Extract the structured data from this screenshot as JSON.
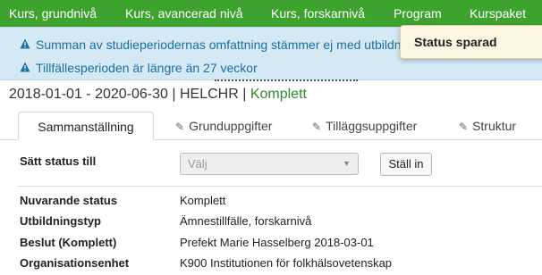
{
  "topnav": {
    "items": [
      "Kurs, grundnivå",
      "Kurs, avancerad nivå",
      "Kurs, forskarnivå",
      "Program",
      "Kurspaket"
    ]
  },
  "alerts": {
    "items": [
      "Summan av studieperiodernas omfattning stämmer ej med utbildn",
      "Tillfällesperioden är längre än 27 veckor"
    ]
  },
  "toast": {
    "message": "Status sparad"
  },
  "subheader": {
    "period": "2018-01-01 - 2020-06-30",
    "code": "HELCHR",
    "separator": "|",
    "status": "Komplett"
  },
  "tabs": [
    {
      "label": "Sammanställning",
      "active": true
    },
    {
      "label": "Grunduppgifter",
      "active": false
    },
    {
      "label": "Tilläggsuppgifter",
      "active": false
    },
    {
      "label": "Struktur",
      "active": false
    }
  ],
  "status_form": {
    "label": "Sätt status till",
    "select_value": "Välj",
    "button_label": "Ställ in"
  },
  "details": [
    {
      "key": "Nuvarande status",
      "value": "Komplett"
    },
    {
      "key": "Utbildningstyp",
      "value": "Ämnestillfälle, forskarnivå"
    },
    {
      "key": "Beslut (Komplett)",
      "value": "Prefekt Marie Hasselberg 2018-03-01"
    },
    {
      "key": "Organisationsenhet",
      "value": "K900 Institutionen för folkhälsovetenskap"
    }
  ],
  "colors": {
    "nav": "#3ea22f",
    "alert_bg": "#d5e9f5",
    "alert_text": "#1c6ea4",
    "status_green": "#2b8a2b",
    "toast_bg": "#fcf6e3"
  },
  "icons": {
    "alert": "warning-triangle-icon",
    "tab": "pencil-icon",
    "select": "caret-down-icon"
  }
}
